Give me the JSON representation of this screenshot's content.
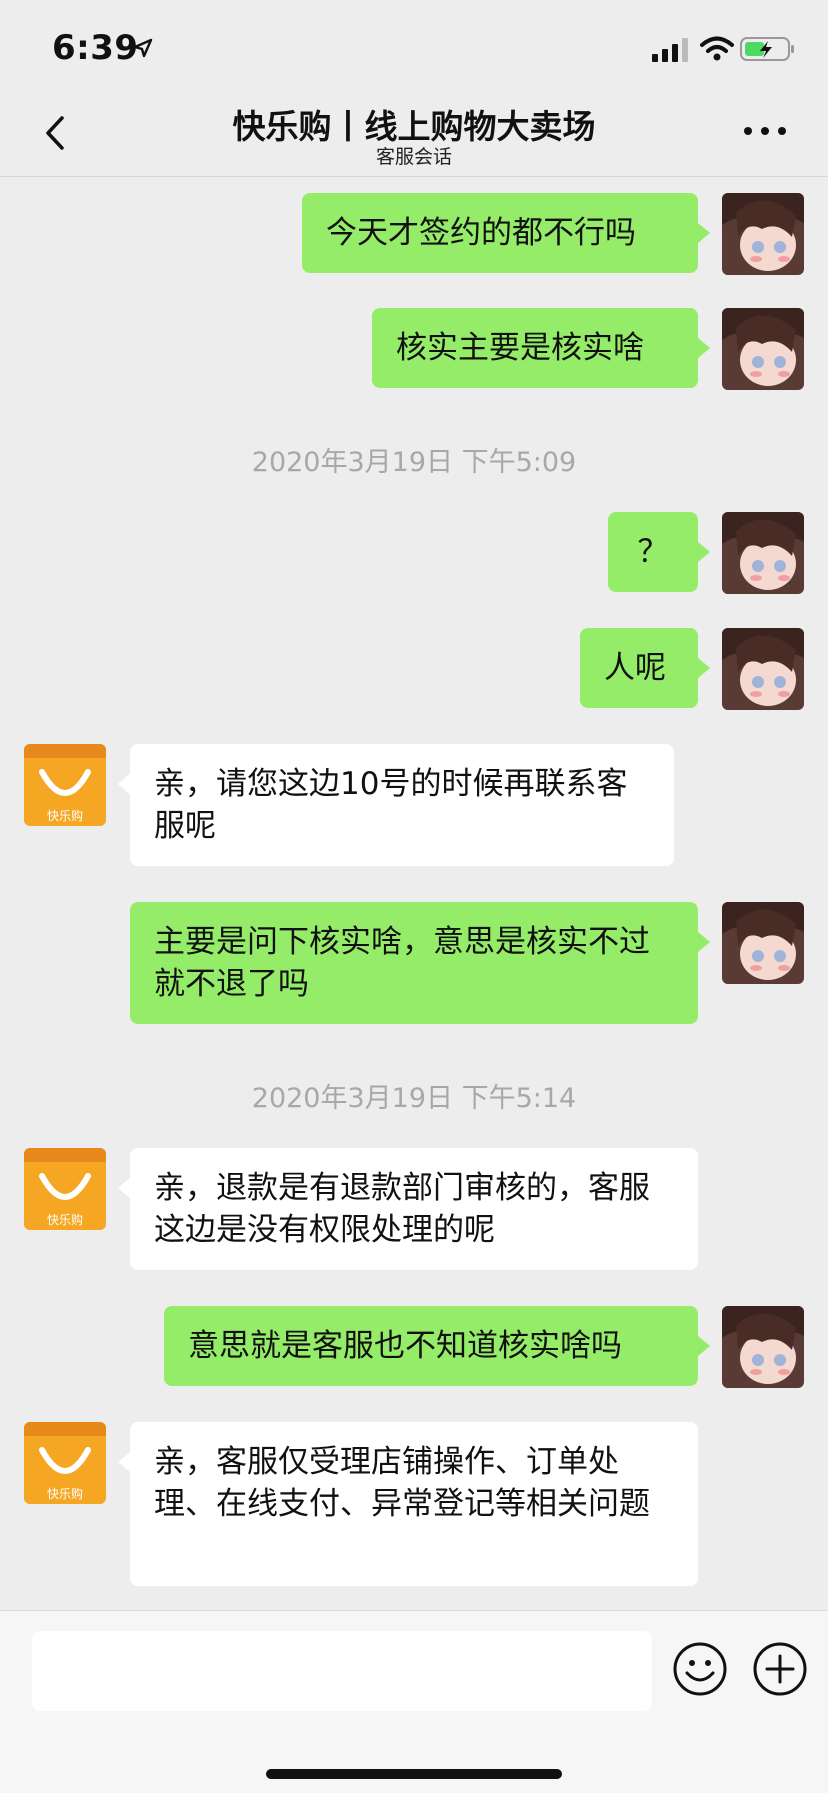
{
  "status": {
    "time": "6:39"
  },
  "header": {
    "title": "快乐购丨线上购物大卖场",
    "subtitle": "客服会话"
  },
  "shop_avatar_label": "快乐购",
  "timestamps": [
    "2020年3月19日 下午5:09",
    "2020年3月19日 下午5:14"
  ],
  "messages": [
    {
      "sender": "me",
      "text": "今天才签约的都不行吗"
    },
    {
      "sender": "me",
      "text": "核实主要是核实啥"
    },
    {
      "sender": "me",
      "text": "？"
    },
    {
      "sender": "me",
      "text": "人呢"
    },
    {
      "sender": "shop",
      "text": "亲，请您这边10号的时候再联系客服呢"
    },
    {
      "sender": "me",
      "text": "主要是问下核实啥，意思是核实不过就不退了吗"
    },
    {
      "sender": "shop",
      "text": "亲，退款是有退款部门审核的，客服这边是没有权限处理的呢"
    },
    {
      "sender": "me",
      "text": "意思就是客服也不知道核实啥吗"
    },
    {
      "sender": "shop",
      "text": "亲，客服仅受理店铺操作、订单处理、在线支付、异常登记等相关问题"
    }
  ],
  "input": {
    "value": "",
    "placeholder": ""
  },
  "colors": {
    "my_bubble": "#95ec69",
    "their_bubble": "#ffffff",
    "background": "#ededed",
    "shop_brand": "#f5a623"
  },
  "icons": [
    "back-chevron-icon",
    "more-dots-icon",
    "emoji-icon",
    "plus-icon",
    "signal-icon",
    "wifi-icon",
    "battery-icon",
    "location-arrow-icon"
  ]
}
